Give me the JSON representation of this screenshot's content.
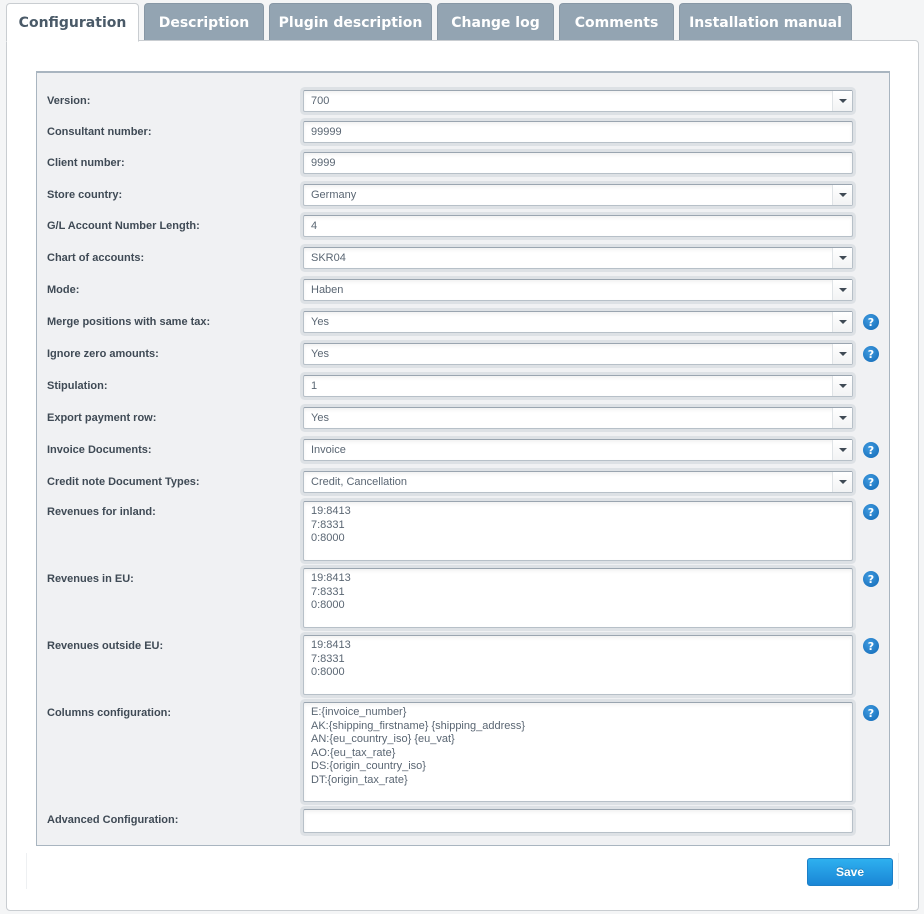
{
  "tabs": [
    {
      "label": "Configuration",
      "active": true
    },
    {
      "label": "Description",
      "active": false
    },
    {
      "label": "Plugin description",
      "active": false
    },
    {
      "label": "Change log",
      "active": false
    },
    {
      "label": "Comments",
      "active": false
    },
    {
      "label": "Installation manual",
      "active": false
    }
  ],
  "form": {
    "fields": [
      {
        "label": "Version:",
        "type": "select",
        "value": "700",
        "help": false
      },
      {
        "label": "Consultant number:",
        "type": "text",
        "value": "99999",
        "help": false
      },
      {
        "label": "Client number:",
        "type": "text",
        "value": "9999",
        "help": false
      },
      {
        "label": "Store country:",
        "type": "select",
        "value": "Germany",
        "help": false
      },
      {
        "label": "G/L Account Number Length:",
        "type": "text",
        "value": "4",
        "help": false
      },
      {
        "label": "Chart of accounts:",
        "type": "select",
        "value": "SKR04",
        "help": false
      },
      {
        "label": "Mode:",
        "type": "select",
        "value": "Haben",
        "help": false
      },
      {
        "label": "Merge positions with same tax:",
        "type": "select",
        "value": "Yes",
        "help": true
      },
      {
        "label": "Ignore zero amounts:",
        "type": "select",
        "value": "Yes",
        "help": true
      },
      {
        "label": "Stipulation:",
        "type": "select",
        "value": "1",
        "help": false
      },
      {
        "label": "Export payment row:",
        "type": "select",
        "value": "Yes",
        "help": false
      },
      {
        "label": "Invoice Documents:",
        "type": "select",
        "value": "Invoice",
        "help": true
      },
      {
        "label": "Credit note Document Types:",
        "type": "select",
        "value": "Credit, Cancellation",
        "help": true
      },
      {
        "label": "Revenues for inland:",
        "type": "textarea",
        "value": "19:8413\n7:8331\n0:8000",
        "help": true
      },
      {
        "label": "Revenues in EU:",
        "type": "textarea",
        "value": "19:8413\n7:8331\n0:8000",
        "help": true
      },
      {
        "label": "Revenues outside EU:",
        "type": "textarea",
        "value": "19:8413\n7:8331\n0:8000",
        "help": true
      },
      {
        "label": "Columns configuration:",
        "type": "textarea",
        "value": "E:{invoice_number}\nAK:{shipping_firstname} {shipping_address}\nAN:{eu_country_iso} {eu_vat}\nAO:{eu_tax_rate}\nDS:{origin_country_iso}\nDT:{origin_tax_rate}",
        "help": true
      },
      {
        "label": "Advanced Configuration:",
        "type": "text",
        "value": "",
        "help": false
      }
    ]
  },
  "help_icon": {
    "glyph": "?",
    "name": "help-icon",
    "color": "#1a7cc9"
  },
  "select_arrow_icon": "chevron-down-icon",
  "save_label": "Save",
  "colors": {
    "accent": "#1a86d6",
    "tab_inactive": "#93a4b2",
    "form_bg": "#f0f1f3"
  }
}
